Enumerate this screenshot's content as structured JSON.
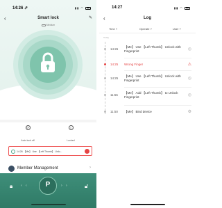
{
  "left_screen": {
    "status_time": "14:26 ⇗",
    "title": "Smart lock",
    "bt_status": "Medium",
    "actions": [
      {
        "label": "Auto lock off",
        "icon": "auto-lock-icon"
      },
      {
        "label": "Locked",
        "icon": "locked-status-icon"
      }
    ],
    "log_banner": "14:26 【Me】 Use 【Left Thumb】 Unlo...",
    "member_label": "Member Management",
    "bottom": {
      "center_key": "P",
      "arrows_left": "‹ ‹",
      "arrows_right": "› ›"
    }
  },
  "right_screen": {
    "status_time": "14:27",
    "title": "Log",
    "filters": {
      "time": "Time ˅",
      "operate": "Operate ˅",
      "user": "User ˅"
    },
    "section_label": "Today",
    "entries": [
      {
        "time": "14:26",
        "text": "【Me】 Use 【Left Thumb】 Unlock with Fingerprint",
        "alert": false,
        "icon": "fingerprint-icon"
      },
      {
        "time": "14:25",
        "text": "Wrong Finger",
        "alert": true,
        "icon": "warning-icon"
      },
      {
        "time": "14:25",
        "text": "【Me】 Use 【Left Thumb】 Unlock with Fingerprint",
        "alert": false,
        "icon": "fingerprint-icon"
      },
      {
        "time": "11:55",
        "text": "【Me】 Add 【Left Thumb】 to Unlock Fingerprint",
        "alert": false,
        "icon": "fingerprint-add-icon"
      },
      {
        "time": "11:50",
        "text": "【Me】 Bind device",
        "alert": false,
        "icon": "bind-device-icon"
      }
    ]
  },
  "colors": {
    "accent": "#3f8f7a",
    "alert": "#e54545",
    "lock_circle": "#7fc4ac"
  }
}
